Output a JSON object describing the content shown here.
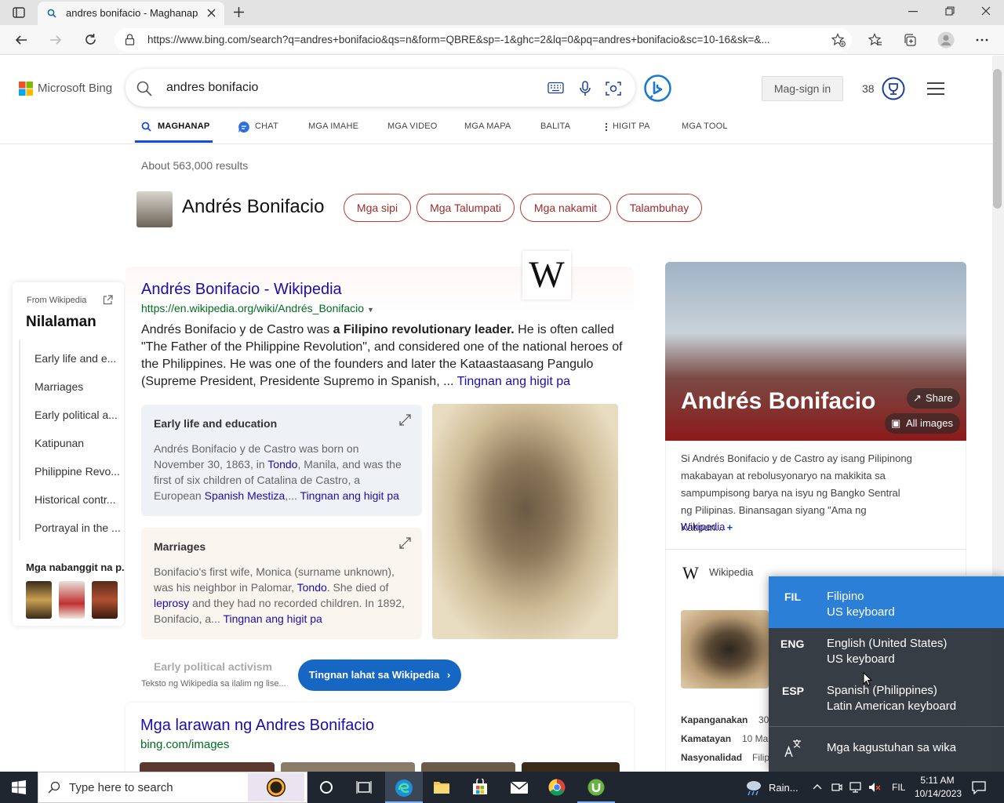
{
  "browser": {
    "tab_title": "andres bonifacio - Maghanap",
    "url": "https://www.bing.com/search?q=andres+bonifacio&qs=n&form=QBRE&sp=-1&ghc=2&lq=0&pq=andres+bonifacio&sc=10-16&sk=&..."
  },
  "bing": {
    "logo": "Microsoft Bing",
    "query": "andres bonifacio",
    "signin_label": "Mag-sign in",
    "points": "38",
    "nav_tabs": [
      "MAGHANAP",
      "CHAT",
      "MGA IMAHE",
      "MGA VIDEO",
      "MGA MAPA",
      "BALITA",
      "HIGIT PA",
      "MGA TOOL"
    ],
    "results_count": "About 563,000 results"
  },
  "entity": {
    "name": "Andrés Bonifacio",
    "pills": [
      "Mga sipi",
      "Mga Talumpati",
      "Mga nakamit",
      "Talambuhay"
    ]
  },
  "toc": {
    "from": "From Wikipedia",
    "title": "Nilalaman",
    "items": [
      "Early life and e...",
      "Marriages",
      "Early political a...",
      "Katipunan",
      "Philippine Revo...",
      "Historical contr...",
      "Portrayal in the ..."
    ],
    "related_title": "Mga nabanggit na p..."
  },
  "result": {
    "title": "Andrés Bonifacio - Wikipedia",
    "url": "https://en.wikipedia.org/wiki/Andrés_Bonifacio",
    "snippet_pre": "Andrés Bonifacio y de Castro was ",
    "snippet_bold": "a Filipino revolutionary leader.",
    "snippet_post": " He is often called \"The Father of the Philippine Revolution\", and considered one of the national heroes of the Philippines. He was one of the founders and later the Kataastaasang Pangulo (Supreme President, Presidente Supremo in Spanish, ... ",
    "more": "Tingnan ang higit pa",
    "sections": [
      {
        "title": "Early life and education",
        "text_a": "Andrés Bonifacio y de Castro was born on November 30, 1863, in ",
        "link_a": "Tondo",
        "text_b": ", Manila, and was the first of six children of Catalina de Castro, a European ",
        "link_b": "Spanish Mestiza",
        "text_c": ",... ",
        "more": "Tingnan ang higit pa"
      },
      {
        "title": "Marriages",
        "text_a": "Bonifacio's first wife, Monica (surname unknown), was his neighbor in Palomar, ",
        "link_a": "Tondo",
        "text_b": ". She died of ",
        "link_b": "leprosy",
        "text_c": " and they had no recorded children. In 1892, Bonifacio, a... ",
        "more": "Tingnan ang higit pa"
      }
    ],
    "third_section": "Early political activism",
    "see_all": "Tingnan lahat sa Wikipedia",
    "license": "Teksto ng Wikipedia sa ilalim ng lise..."
  },
  "images_result": {
    "title": "Mga larawan ng Andres Bonifacio",
    "url": "bing.com/images"
  },
  "right_pane": {
    "name": "Andrés Bonifacio",
    "share": "Share",
    "all_images": "All images",
    "description": "Si Andrés Bonifacio y de Castro ay isang Pilipinong makabayan at rebolusyonaryo na makikita sa sampumpisong barya na isyu ng Bangko Sentral ng Pilipinas. Binansagan siyang \"Ama ng Katipun...",
    "source_link": "Wikipedia",
    "wiki_label": "Wikipedia",
    "facts": [
      {
        "key": "Kapanganakan",
        "value": "30"
      },
      {
        "key": "Kamatayan",
        "value": "10 Ma"
      },
      {
        "key": "Nasyonalidad",
        "value": "Filip"
      }
    ]
  },
  "language_popup": {
    "options": [
      {
        "code": "FIL",
        "name": "Filipino",
        "keyboard": "US keyboard",
        "selected": true
      },
      {
        "code": "ENG",
        "name": "English (United States)",
        "keyboard": "US keyboard",
        "selected": false
      },
      {
        "code": "ESP",
        "name": "Spanish (Philippines)",
        "keyboard": "Latin American keyboard",
        "selected": false
      }
    ],
    "preferences": "Mga kagustuhan sa wika"
  },
  "taskbar": {
    "search_placeholder": "Type here to search",
    "weather": "Rain...",
    "lang": "FIL",
    "time": "5:11 AM",
    "date": "10/14/2023"
  },
  "colors": {
    "bing_blue": "#174ae4",
    "link": "#1a0dab",
    "url_green": "#006d21",
    "pill_red": "#c0392b",
    "lang_selected": "#2b7fd6"
  }
}
